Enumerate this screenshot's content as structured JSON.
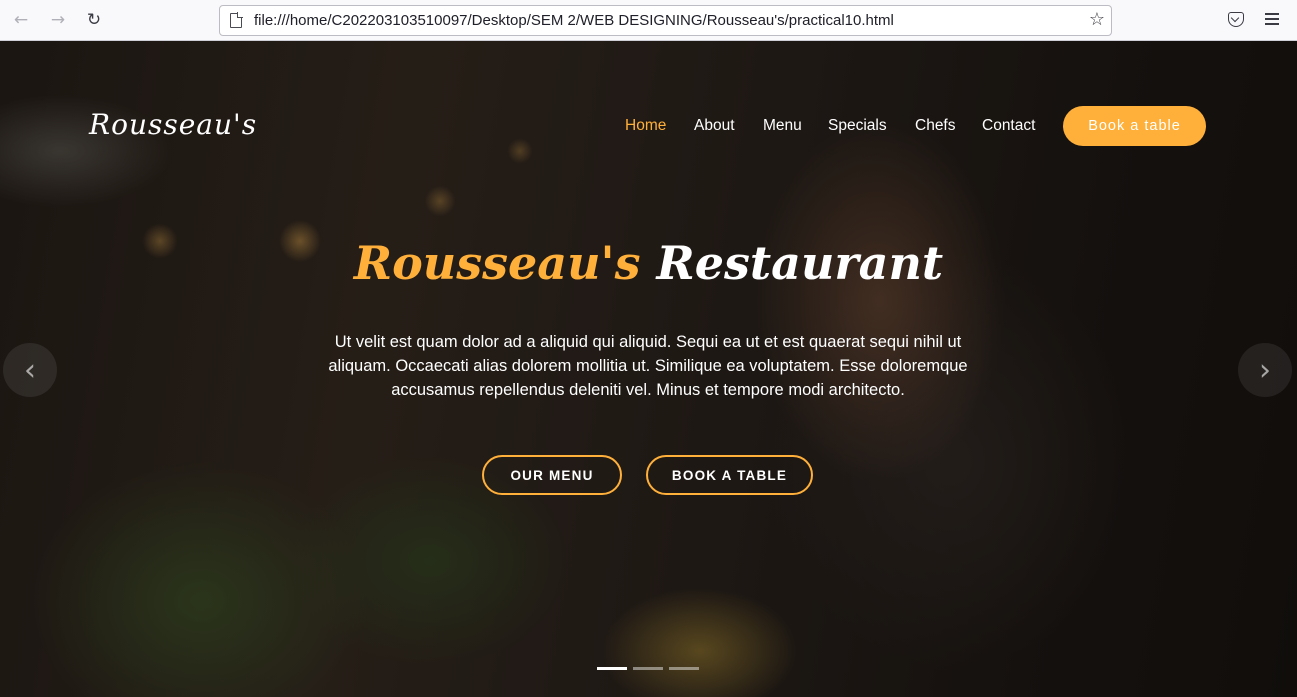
{
  "browser": {
    "back_glyph": "←",
    "forward_glyph": "→",
    "reload_glyph": "↻",
    "url": "file:///home/C202203103510097/Desktop/SEM 2/WEB DESIGNING/Rousseau's/practical10.html",
    "star_glyph": "☆"
  },
  "site": {
    "logo": "Rousseau's",
    "nav": {
      "home": "Home",
      "about": "About",
      "menu": "Menu",
      "specials": "Specials",
      "chefs": "Chefs",
      "contact": "Contact"
    },
    "book_button": "Book a table"
  },
  "hero": {
    "title_brand": "Rousseau's",
    "title_rest": " Restaurant",
    "description": "Ut velit est quam dolor ad a aliquid qui aliquid. Sequi ea ut et est quaerat sequi nihil ut aliquam. Occaecati alias dolorem mollitia ut. Similique ea voluptatem. Esse doloremque accusamus repellendus deleniti vel. Minus et tempore modi architecto.",
    "menu_button": "OUR MENU",
    "book_button": "BOOK A TABLE",
    "prev_glyph": "‹",
    "next_glyph": "›",
    "active_slide": 1,
    "slide_count": 3
  },
  "colors": {
    "accent": "#ffb03b",
    "text": "#ffffff"
  }
}
